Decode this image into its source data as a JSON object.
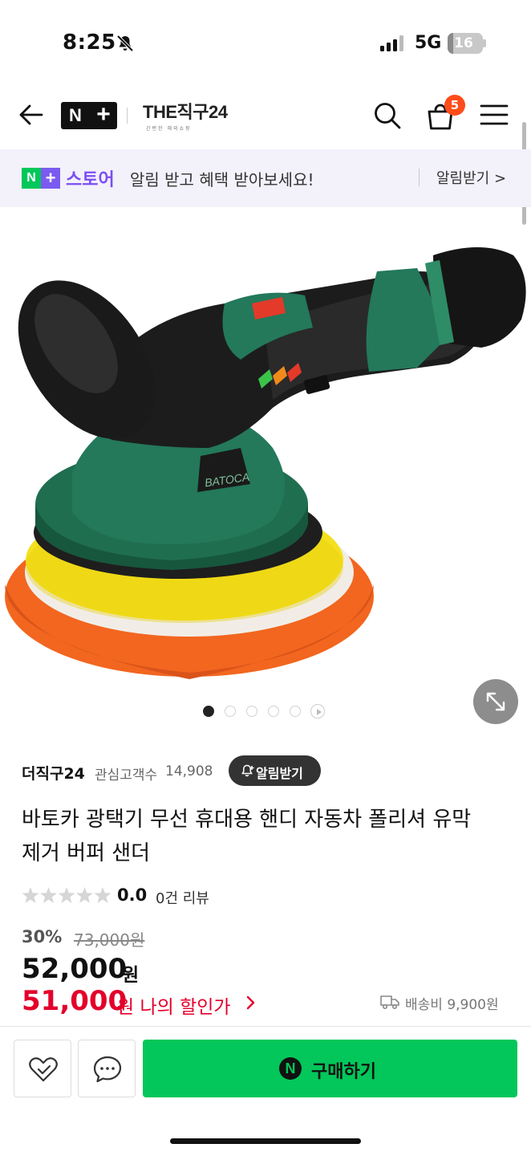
{
  "status_bar": {
    "time": "8:25",
    "network": "5G",
    "battery": "16",
    "battery_level": 0.16
  },
  "header": {
    "brand_n": "N",
    "brand_plus": "+",
    "store_logo": "THE직구24",
    "store_logo_sub": "간편한 해외쇼핑",
    "cart_count": "5",
    "icons": [
      "back-arrow-icon",
      "search-icon",
      "shopping-bag-icon",
      "menu-icon"
    ]
  },
  "banner": {
    "logo_n": "N",
    "logo_plus": "+",
    "store_label": "스토어",
    "message": "알림 받고 혜택 받아보세요!",
    "action": "알림받기 >"
  },
  "gallery": {
    "total_images": 5,
    "current_index": 1,
    "has_video": true
  },
  "seller": {
    "name": "더직구24",
    "fav_label": "관심고객수",
    "fav_count": "14,908",
    "alarm_button": "알림받기"
  },
  "product": {
    "title_line1": "바토카 광택기 무선 휴대용 핸디 자동차 폴리셔 유막",
    "title_line2": "제거 버퍼 샌더",
    "rating": "0.0",
    "review_count": "0건 리뷰",
    "stars_filled": 0,
    "discount_rate": "30%",
    "original_price": "73,000원",
    "price": "52,000",
    "price_unit": "원",
    "my_price": "51,000",
    "my_price_label": "원 나의 할인가",
    "shipping": "배송비 9,900원"
  },
  "bottom_bar": {
    "buy_label": "구매하기",
    "npay_mark": "N"
  },
  "colors": {
    "naver_green": "#03c75a",
    "plus_purple": "#7b4df5",
    "sale_red": "#e3002b",
    "badge_orange": "#ff4c1a"
  }
}
